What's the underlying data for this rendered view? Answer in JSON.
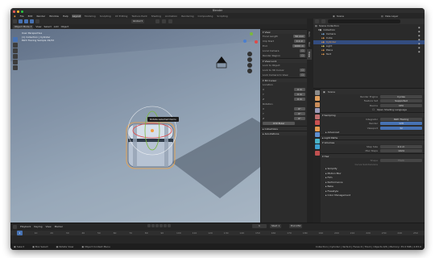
{
  "window": {
    "title": "Blender"
  },
  "menubar": {
    "items": [
      "File",
      "Edit",
      "Render",
      "Window",
      "Help"
    ],
    "tabs": [
      "Layout",
      "Modeling",
      "Sculpting",
      "UV Editing",
      "Texture Paint",
      "Shading",
      "Animation",
      "Rendering",
      "Compositing",
      "Scripting"
    ],
    "scene_label": "Scene",
    "view_layer_label": "View Layer"
  },
  "viewport": {
    "header_mode": "Object Mode",
    "header_menus": [
      "View",
      "Select",
      "Add",
      "Object"
    ],
    "transform_orientation": "Global",
    "info_lines": [
      "User Perspective",
      "(1) Collection | Cylinder",
      "Path Tracing Sample 19/32"
    ],
    "tooltip": "Rotate selected items"
  },
  "npanel": {
    "tabs": [
      "Item",
      "Tool",
      "View"
    ],
    "view_header": "View",
    "focal_length_label": "Focal Length",
    "focal_length": "50 mm",
    "clip_start_label": "Clip Start",
    "clip_start": "0.1 m",
    "clip_end_label": "End",
    "clip_end": "1000 m",
    "local_camera_label": "Local Camera",
    "render_region_label": "Render Region",
    "view_lock_header": "View Lock",
    "lock_to_object_label": "Lock to Object",
    "lock_3d_cursor_label": "Lock to 3D Cursor",
    "lock_camera_label": "Lock Camera to View",
    "cursor_header": "3D Cursor",
    "location_label": "Location",
    "loc": [
      {
        "axis": "X",
        "value": "0 m"
      },
      {
        "axis": "Y",
        "value": "0 m"
      },
      {
        "axis": "Z",
        "value": "0 m"
      }
    ],
    "rotation_label": "Rotation",
    "rot": [
      {
        "axis": "X",
        "value": "0°"
      },
      {
        "axis": "Y",
        "value": "0°"
      },
      {
        "axis": "Z",
        "value": "0°"
      }
    ],
    "rotation_mode": "XYZ Euler",
    "collections_header": "Collections",
    "annotations_header": "Annotations"
  },
  "outliner": {
    "root": "Scene Collection",
    "items": [
      {
        "label": "Collection",
        "color": "#d0d0d0",
        "selected": false
      },
      {
        "label": "Camera",
        "color": "#7fb3e6",
        "selected": false
      },
      {
        "label": "Cube",
        "color": "#e39a4f",
        "selected": false
      },
      {
        "label": "Cylinder",
        "color": "#e39a4f",
        "selected": true
      },
      {
        "label": "Light",
        "color": "#e6d36b",
        "selected": false
      },
      {
        "label": "Plane",
        "color": "#e39a4f",
        "selected": false
      },
      {
        "label": "Text",
        "color": "#e39a4f",
        "selected": false
      }
    ]
  },
  "properties": {
    "scene_name": "Scene",
    "render_engine_label": "Render Engine",
    "render_engine": "Cycles",
    "feature_set_label": "Feature Set",
    "feature_set": "Supported",
    "device_label": "Device",
    "device": "CPU",
    "osl_label": "Open Shading Language",
    "sampling_header": "Sampling",
    "integrator_label": "Integrator",
    "integrator": "Path Tracing",
    "render_label": "Render",
    "render_samples": "128",
    "viewport_label": "Viewport",
    "viewport_samples": "32",
    "advanced_label": "Advanced",
    "light_paths_header": "Light Paths",
    "volumes_header": "Volumes",
    "step_size_label": "Step Size",
    "step_size": "0.1 m",
    "max_steps_label": "Max Steps",
    "max_steps": "1024",
    "hair_header": "Hair",
    "shape_label": "Shape",
    "shape_value": "Thick",
    "curve_subdiv_label": "Curve Subdivisions",
    "collapsed": [
      "Simplify",
      "Motion Blur",
      "Film",
      "Performance",
      "Bake",
      "Freestyle",
      "Color Management"
    ]
  },
  "timeline": {
    "menus": [
      "Playback",
      "Keying",
      "View",
      "Marker"
    ],
    "current_frame": "1",
    "start_label": "Start",
    "start": "1",
    "end_label": "End",
    "end": "250",
    "ticks": [
      "0",
      "10",
      "20",
      "30",
      "40",
      "50",
      "60",
      "70",
      "80",
      "90",
      "100",
      "110",
      "120",
      "130",
      "140",
      "150",
      "160",
      "170",
      "180",
      "190",
      "200",
      "210",
      "220",
      "230",
      "240",
      "250"
    ]
  },
  "statusbar": {
    "select": "Select",
    "box_select": "Box Select",
    "rotate_view": "Rotate View",
    "context_menu": "Object Context Menu",
    "stats": "Collection | Cylinder | Verts:0 | Faces:0 | Tris:0 | Objects:0/6 | Memory: 35.0 MiB | 2.83.0"
  },
  "colors": {
    "accent": "#4772b3",
    "selection": "#334d80",
    "active_orange": "#f0a040"
  }
}
